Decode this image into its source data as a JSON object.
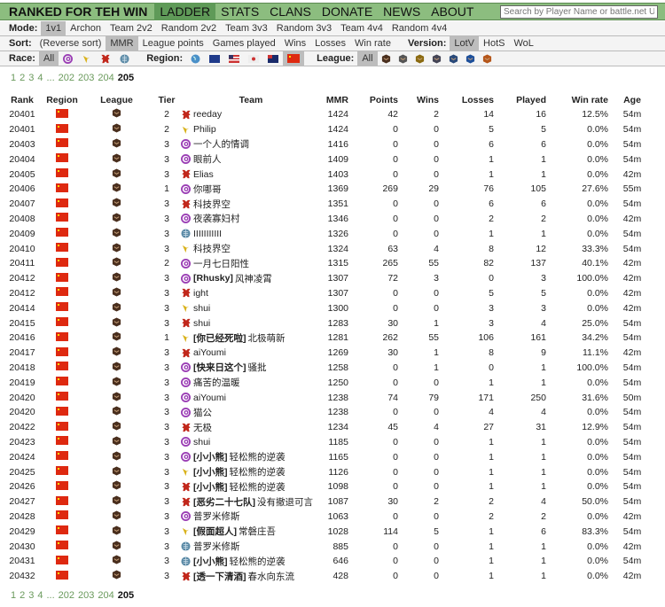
{
  "header": {
    "brand": "RANKED FOR TEH WIN",
    "nav": [
      {
        "label": "LADDER",
        "active": true
      },
      {
        "label": "STATS"
      },
      {
        "label": "CLANS"
      },
      {
        "label": "DONATE"
      },
      {
        "label": "NEWS"
      },
      {
        "label": "ABOUT"
      }
    ],
    "search_placeholder": "Search by Player Name or battle.net URL"
  },
  "mode": {
    "label": "Mode:",
    "options": [
      "1v1",
      "Archon",
      "Team 2v2",
      "Random 2v2",
      "Team 3v3",
      "Random 3v3",
      "Team 4v4",
      "Random 4v4"
    ],
    "selected": "1v1"
  },
  "sort": {
    "label": "Sort:",
    "options": [
      "(Reverse sort)",
      "MMR",
      "League points",
      "Games played",
      "Wins",
      "Losses",
      "Win rate"
    ],
    "selected": "MMR",
    "version_label": "Version:",
    "versions": [
      "LotV",
      "HotS",
      "WoL"
    ],
    "version_selected": "LotV"
  },
  "filters": {
    "race_label": "Race:",
    "race_all": "All",
    "races": [
      "zerg",
      "protoss",
      "terran",
      "random"
    ],
    "region_label": "Region:",
    "regions": [
      "world",
      "eu",
      "us",
      "kr",
      "sea",
      "cn"
    ],
    "region_selected": "cn",
    "league_label": "League:",
    "league_all": "All",
    "leagues": [
      "bronze",
      "silver",
      "gold",
      "platinum",
      "diamond",
      "master",
      "grandmaster"
    ]
  },
  "pagination": {
    "pages": [
      "1",
      "2",
      "3",
      "4",
      "...",
      "202",
      "203",
      "204",
      "205"
    ],
    "current": "205"
  },
  "colors": {
    "nav_bg": "#8cbd7f",
    "nav_active": "#5f9a58",
    "link": "#6a9a5c",
    "zerg": "#9b3fb5",
    "protoss": "#d9b21c",
    "terran": "#c1271b",
    "random": "#5b8aa6",
    "bronze": "#4a2f1e"
  },
  "table": {
    "headers": [
      "Rank",
      "Region",
      "League",
      "Tier",
      "Team",
      "MMR",
      "Points",
      "Wins",
      "Losses",
      "Played",
      "Win rate",
      "Age"
    ],
    "rows": [
      {
        "rank": "20401",
        "region": "cn",
        "league": "bronze",
        "tier": "2",
        "race": "terran",
        "clan": "",
        "name": "reeday",
        "mmr": "1424",
        "points": "42",
        "wins": "2",
        "losses": "14",
        "played": "16",
        "winrate": "12.5%",
        "age": "54m"
      },
      {
        "rank": "20401",
        "region": "cn",
        "league": "bronze",
        "tier": "2",
        "race": "protoss",
        "clan": "",
        "name": "Philip",
        "mmr": "1424",
        "points": "0",
        "wins": "0",
        "losses": "5",
        "played": "5",
        "winrate": "0.0%",
        "age": "54m"
      },
      {
        "rank": "20403",
        "region": "cn",
        "league": "bronze",
        "tier": "3",
        "race": "zerg",
        "clan": "",
        "name": "一个人的情调",
        "mmr": "1416",
        "points": "0",
        "wins": "0",
        "losses": "6",
        "played": "6",
        "winrate": "0.0%",
        "age": "54m"
      },
      {
        "rank": "20404",
        "region": "cn",
        "league": "bronze",
        "tier": "3",
        "race": "zerg",
        "clan": "",
        "name": "眼前人",
        "mmr": "1409",
        "points": "0",
        "wins": "0",
        "losses": "1",
        "played": "1",
        "winrate": "0.0%",
        "age": "54m"
      },
      {
        "rank": "20405",
        "region": "cn",
        "league": "bronze",
        "tier": "3",
        "race": "terran",
        "clan": "",
        "name": "Elias",
        "mmr": "1403",
        "points": "0",
        "wins": "0",
        "losses": "1",
        "played": "1",
        "winrate": "0.0%",
        "age": "42m"
      },
      {
        "rank": "20406",
        "region": "cn",
        "league": "bronze",
        "tier": "1",
        "race": "zerg",
        "clan": "",
        "name": "你哪哥",
        "mmr": "1369",
        "points": "269",
        "wins": "29",
        "losses": "76",
        "played": "105",
        "winrate": "27.6%",
        "age": "55m"
      },
      {
        "rank": "20407",
        "region": "cn",
        "league": "bronze",
        "tier": "3",
        "race": "terran",
        "clan": "",
        "name": "科技界空",
        "mmr": "1351",
        "points": "0",
        "wins": "0",
        "losses": "6",
        "played": "6",
        "winrate": "0.0%",
        "age": "54m"
      },
      {
        "rank": "20408",
        "region": "cn",
        "league": "bronze",
        "tier": "3",
        "race": "zerg",
        "clan": "",
        "name": "夜袭寡妇村",
        "mmr": "1346",
        "points": "0",
        "wins": "0",
        "losses": "2",
        "played": "2",
        "winrate": "0.0%",
        "age": "42m"
      },
      {
        "rank": "20409",
        "region": "cn",
        "league": "bronze",
        "tier": "3",
        "race": "random",
        "clan": "",
        "name": "IIIIIIIIIII",
        "mmr": "1326",
        "points": "0",
        "wins": "0",
        "losses": "1",
        "played": "1",
        "winrate": "0.0%",
        "age": "54m"
      },
      {
        "rank": "20410",
        "region": "cn",
        "league": "bronze",
        "tier": "3",
        "race": "protoss",
        "clan": "",
        "name": "科技界空",
        "mmr": "1324",
        "points": "63",
        "wins": "4",
        "losses": "8",
        "played": "12",
        "winrate": "33.3%",
        "age": "54m"
      },
      {
        "rank": "20411",
        "region": "cn",
        "league": "bronze",
        "tier": "2",
        "race": "zerg",
        "clan": "",
        "name": "一月七日阳性",
        "mmr": "1315",
        "points": "265",
        "wins": "55",
        "losses": "82",
        "played": "137",
        "winrate": "40.1%",
        "age": "42m"
      },
      {
        "rank": "20412",
        "region": "cn",
        "league": "bronze",
        "tier": "3",
        "race": "zerg",
        "clan": "[Rhusky]",
        "name": "风神凌霄",
        "mmr": "1307",
        "points": "72",
        "wins": "3",
        "losses": "0",
        "played": "3",
        "winrate": "100.0%",
        "age": "42m"
      },
      {
        "rank": "20412",
        "region": "cn",
        "league": "bronze",
        "tier": "3",
        "race": "terran",
        "clan": "",
        "name": "ight",
        "mmr": "1307",
        "points": "0",
        "wins": "0",
        "losses": "5",
        "played": "5",
        "winrate": "0.0%",
        "age": "42m"
      },
      {
        "rank": "20414",
        "region": "cn",
        "league": "bronze",
        "tier": "3",
        "race": "protoss",
        "clan": "",
        "name": "shui",
        "mmr": "1300",
        "points": "0",
        "wins": "0",
        "losses": "3",
        "played": "3",
        "winrate": "0.0%",
        "age": "42m"
      },
      {
        "rank": "20415",
        "region": "cn",
        "league": "bronze",
        "tier": "3",
        "race": "terran",
        "clan": "",
        "name": "shui",
        "mmr": "1283",
        "points": "30",
        "wins": "1",
        "losses": "3",
        "played": "4",
        "winrate": "25.0%",
        "age": "54m"
      },
      {
        "rank": "20416",
        "region": "cn",
        "league": "bronze",
        "tier": "1",
        "race": "protoss",
        "clan": "[你已经死啦]",
        "name": "北极萌新",
        "mmr": "1281",
        "points": "262",
        "wins": "55",
        "losses": "106",
        "played": "161",
        "winrate": "34.2%",
        "age": "54m"
      },
      {
        "rank": "20417",
        "region": "cn",
        "league": "bronze",
        "tier": "3",
        "race": "terran",
        "clan": "",
        "name": "aiYoumi",
        "mmr": "1269",
        "points": "30",
        "wins": "1",
        "losses": "8",
        "played": "9",
        "winrate": "11.1%",
        "age": "42m"
      },
      {
        "rank": "20418",
        "region": "cn",
        "league": "bronze",
        "tier": "3",
        "race": "zerg",
        "clan": "[快来日这个]",
        "name": "骚批",
        "mmr": "1258",
        "points": "0",
        "wins": "1",
        "losses": "0",
        "played": "1",
        "winrate": "100.0%",
        "age": "54m"
      },
      {
        "rank": "20419",
        "region": "cn",
        "league": "bronze",
        "tier": "3",
        "race": "zerg",
        "clan": "",
        "name": "痛苦的温暖",
        "mmr": "1250",
        "points": "0",
        "wins": "0",
        "losses": "1",
        "played": "1",
        "winrate": "0.0%",
        "age": "54m"
      },
      {
        "rank": "20420",
        "region": "cn",
        "league": "bronze",
        "tier": "3",
        "race": "zerg",
        "clan": "",
        "name": "aiYoumi",
        "mmr": "1238",
        "points": "74",
        "wins": "79",
        "losses": "171",
        "played": "250",
        "winrate": "31.6%",
        "age": "50m"
      },
      {
        "rank": "20420",
        "region": "cn",
        "league": "bronze",
        "tier": "3",
        "race": "zerg",
        "clan": "",
        "name": "猫公",
        "mmr": "1238",
        "points": "0",
        "wins": "0",
        "losses": "4",
        "played": "4",
        "winrate": "0.0%",
        "age": "54m"
      },
      {
        "rank": "20422",
        "region": "cn",
        "league": "bronze",
        "tier": "3",
        "race": "terran",
        "clan": "",
        "name": "无极",
        "mmr": "1234",
        "points": "45",
        "wins": "4",
        "losses": "27",
        "played": "31",
        "winrate": "12.9%",
        "age": "54m"
      },
      {
        "rank": "20423",
        "region": "cn",
        "league": "bronze",
        "tier": "3",
        "race": "zerg",
        "clan": "",
        "name": "shui",
        "mmr": "1185",
        "points": "0",
        "wins": "0",
        "losses": "1",
        "played": "1",
        "winrate": "0.0%",
        "age": "54m"
      },
      {
        "rank": "20424",
        "region": "cn",
        "league": "bronze",
        "tier": "3",
        "race": "zerg",
        "clan": "[小小熊]",
        "name": "轻松熊的逆袭",
        "mmr": "1165",
        "points": "0",
        "wins": "0",
        "losses": "1",
        "played": "1",
        "winrate": "0.0%",
        "age": "54m"
      },
      {
        "rank": "20425",
        "region": "cn",
        "league": "bronze",
        "tier": "3",
        "race": "protoss",
        "clan": "[小小熊]",
        "name": "轻松熊的逆袭",
        "mmr": "1126",
        "points": "0",
        "wins": "0",
        "losses": "1",
        "played": "1",
        "winrate": "0.0%",
        "age": "54m"
      },
      {
        "rank": "20426",
        "region": "cn",
        "league": "bronze",
        "tier": "3",
        "race": "terran",
        "clan": "[小小熊]",
        "name": "轻松熊的逆袭",
        "mmr": "1098",
        "points": "0",
        "wins": "0",
        "losses": "1",
        "played": "1",
        "winrate": "0.0%",
        "age": "54m"
      },
      {
        "rank": "20427",
        "region": "cn",
        "league": "bronze",
        "tier": "3",
        "race": "terran",
        "clan": "[恶劣二十七队]",
        "name": "没有撤退可言",
        "mmr": "1087",
        "points": "30",
        "wins": "2",
        "losses": "2",
        "played": "4",
        "winrate": "50.0%",
        "age": "54m"
      },
      {
        "rank": "20428",
        "region": "cn",
        "league": "bronze",
        "tier": "3",
        "race": "zerg",
        "clan": "",
        "name": "普罗米修斯",
        "mmr": "1063",
        "points": "0",
        "wins": "0",
        "losses": "2",
        "played": "2",
        "winrate": "0.0%",
        "age": "42m"
      },
      {
        "rank": "20429",
        "region": "cn",
        "league": "bronze",
        "tier": "3",
        "race": "protoss",
        "clan": "[假面超人]",
        "name": "常磐庄吾",
        "mmr": "1028",
        "points": "114",
        "wins": "5",
        "losses": "1",
        "played": "6",
        "winrate": "83.3%",
        "age": "54m"
      },
      {
        "rank": "20430",
        "region": "cn",
        "league": "bronze",
        "tier": "3",
        "race": "random",
        "clan": "",
        "name": "普罗米修斯",
        "mmr": "885",
        "points": "0",
        "wins": "0",
        "losses": "1",
        "played": "1",
        "winrate": "0.0%",
        "age": "42m"
      },
      {
        "rank": "20431",
        "region": "cn",
        "league": "bronze",
        "tier": "3",
        "race": "random",
        "clan": "[小小熊]",
        "name": "轻松熊的逆袭",
        "mmr": "646",
        "points": "0",
        "wins": "0",
        "losses": "1",
        "played": "1",
        "winrate": "0.0%",
        "age": "54m"
      },
      {
        "rank": "20432",
        "region": "cn",
        "league": "bronze",
        "tier": "3",
        "race": "terran",
        "clan": "[透一下清酒]",
        "name": "春水向东流",
        "mmr": "428",
        "points": "0",
        "wins": "0",
        "losses": "1",
        "played": "1",
        "winrate": "0.0%",
        "age": "42m"
      }
    ]
  }
}
